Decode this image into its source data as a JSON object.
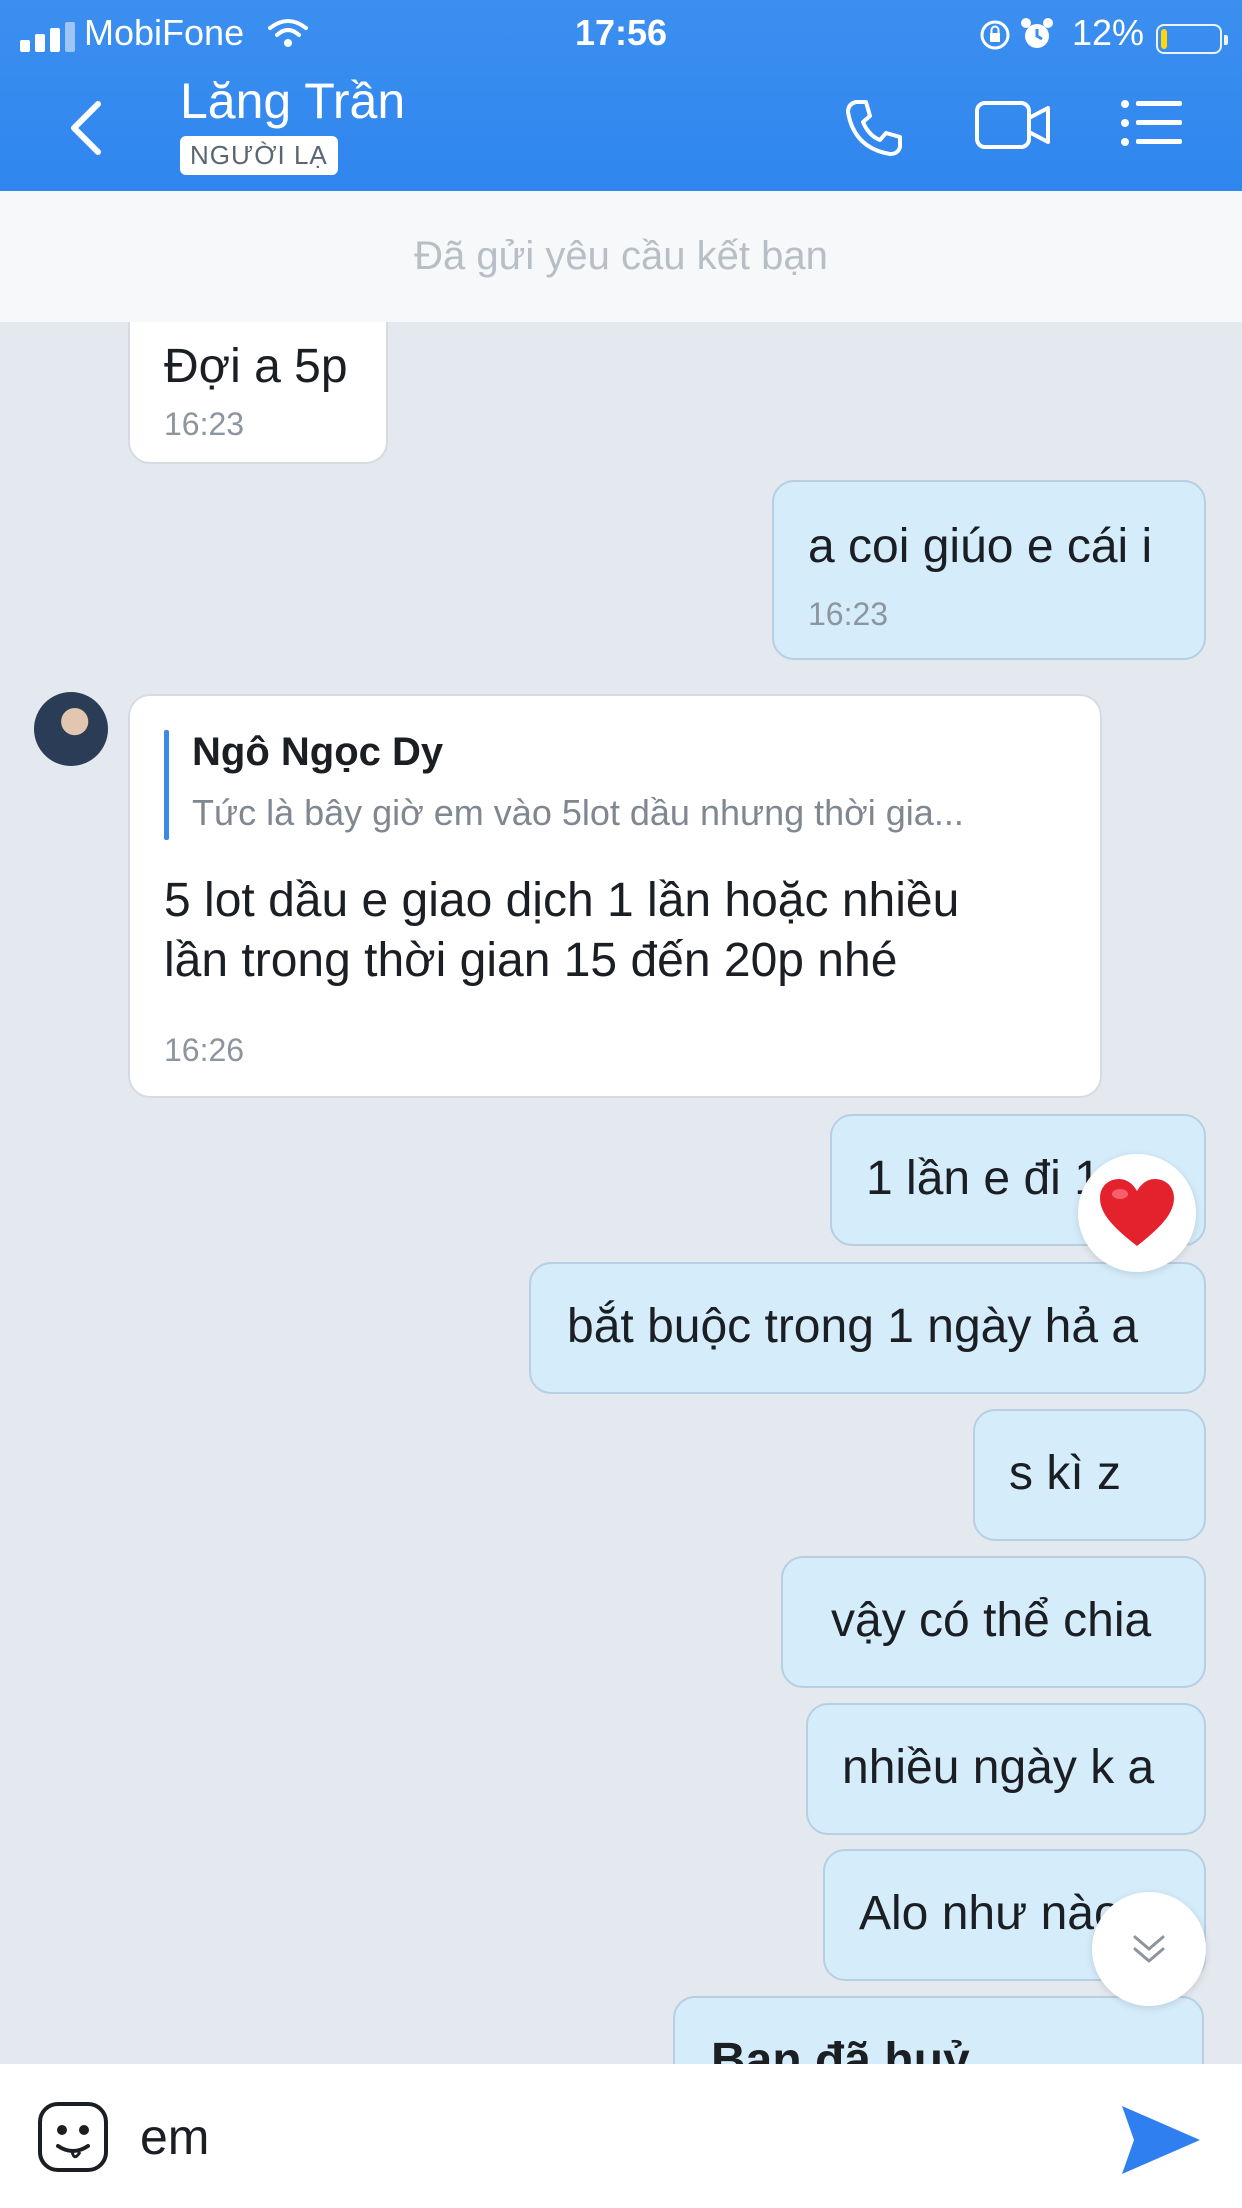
{
  "status_bar": {
    "carrier": "MobiFone",
    "time": "17:56",
    "battery_percent": "12%"
  },
  "header": {
    "title": "Lăng Trần",
    "tag": "NGƯỜI LẠ"
  },
  "banner": {
    "text": "Đã gửi yêu cầu kết bạn"
  },
  "messages": [
    {
      "text": "Đợi a 5p",
      "time": "16:23"
    },
    {
      "text": "a coi giúo e cái i",
      "time": "16:23"
    },
    {
      "quote_name": "Ngô Ngọc Dy",
      "quote_text": "Tức là bây giờ em vào 5lot dầu nhưng thời gia...",
      "line1": "5 lot dầu e giao dịch 1 lần hoặc nhiều",
      "line2": "lần trong thời gian 15 đến 20p nhé",
      "time": "16:26"
    },
    {
      "text": "1 lần e đi 1"
    },
    {
      "text": "bắt buộc trong 1 ngày hả a"
    },
    {
      "text": "s kì z"
    },
    {
      "text": "vậy có thể chia"
    },
    {
      "text": "nhiều ngày k a"
    },
    {
      "text": "Alo như nào a"
    },
    {
      "text": "Bạn đã huỷ"
    }
  ],
  "input": {
    "value": "em"
  },
  "colors": {
    "header_bg": "#3c8ff0",
    "outgoing_bubble": "#d5ecfb",
    "incoming_bubble": "#ffffff",
    "chat_bg": "#e4e8ef",
    "send": "#2f7ff0"
  }
}
